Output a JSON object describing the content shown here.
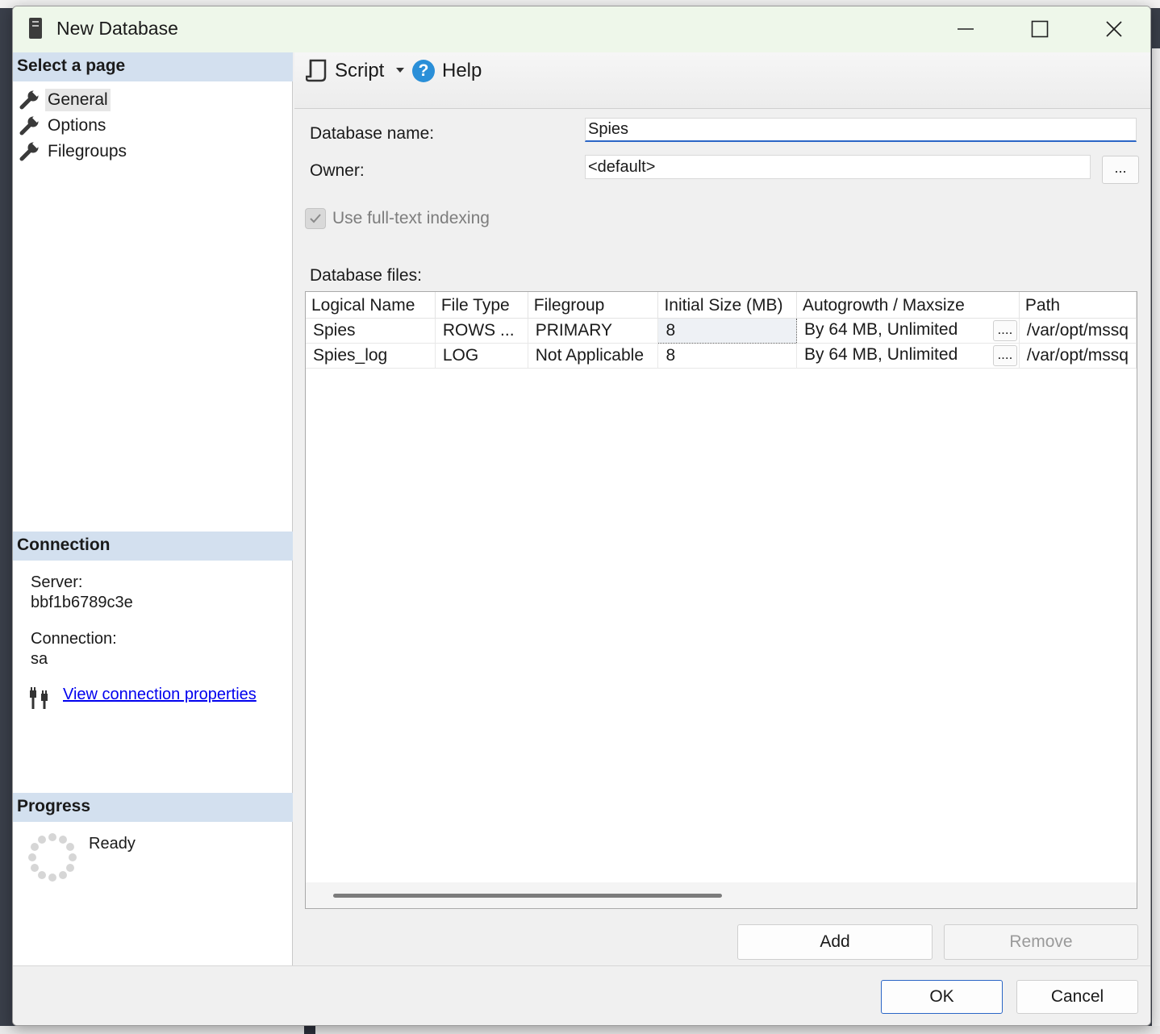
{
  "window": {
    "title": "New Database"
  },
  "left": {
    "select_page_header": "Select a page",
    "pages": [
      {
        "label": "General",
        "selected": true
      },
      {
        "label": "Options",
        "selected": false
      },
      {
        "label": "Filegroups",
        "selected": false
      }
    ],
    "connection_header": "Connection",
    "server_label": "Server:",
    "server_value": "bbf1b6789c3e",
    "connection_label": "Connection:",
    "connection_value": "sa",
    "view_props_link": "View connection properties",
    "progress_header": "Progress",
    "progress_status": "Ready"
  },
  "toolbar": {
    "script_label": "Script",
    "help_label": "Help"
  },
  "form": {
    "db_name_label": "Database name:",
    "db_name_value": "Spies",
    "owner_label": "Owner:",
    "owner_value": "<default>",
    "browse_label": "...",
    "fulltext_label": "Use full-text indexing",
    "fulltext_checked": true,
    "files_label": "Database files:"
  },
  "grid": {
    "columns": [
      "Logical Name",
      "File Type",
      "Filegroup",
      "Initial Size (MB)",
      "Autogrowth / Maxsize",
      "Path"
    ],
    "rows": [
      {
        "logical": "Spies",
        "type": "ROWS ...",
        "filegroup": "PRIMARY",
        "size": "8",
        "growth": "By 64 MB, Unlimited",
        "path": "/var/opt/mssq"
      },
      {
        "logical": "Spies_log",
        "type": "LOG",
        "filegroup": "Not Applicable",
        "size": "8",
        "growth": "By 64 MB, Unlimited",
        "path": "/var/opt/mssq"
      }
    ],
    "dots_label": "...."
  },
  "buttons": {
    "add": "Add",
    "remove": "Remove",
    "ok": "OK",
    "cancel": "Cancel"
  },
  "colors": {
    "title_bg": "#eef7ea",
    "section_bg": "#d3e0ef",
    "accent": "#2b66c6",
    "link": "#0000ee"
  }
}
